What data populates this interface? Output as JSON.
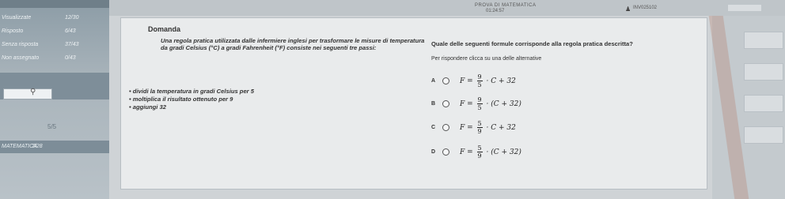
{
  "header": {
    "exam_title": "PROVA DI MATEMATICA",
    "timer": "01:24:57",
    "user_icon": "user-icon",
    "user_id": "INV025102",
    "close_icon": "close-icon"
  },
  "sidebar": {
    "rows": [
      {
        "label": "Visualizzate",
        "value": "12/30"
      },
      {
        "label": "Risposto",
        "value": "6/43"
      },
      {
        "label": "Senza risposta",
        "value": "37/43"
      },
      {
        "label": "Non assegnato",
        "value": "0/43"
      }
    ],
    "score": "5/5",
    "materia": {
      "label": "MATEMATICA",
      "value": "7/28"
    }
  },
  "question": {
    "label": "Domanda",
    "text": "Una regola pratica utilizzata dalle infermiere inglesi per trasformare le misure di temperatura da gradi Celsius (°C) a gradi Fahrenheit (°F) consiste nei seguenti tre passi:",
    "steps": [
      "• dividi la temperatura in gradi Celsius per 5",
      "• moltiplica il risultato ottenuto per 9",
      "• aggiungi 32"
    ]
  },
  "answer": {
    "title": "Quale delle seguenti formule corrisponde alla regola pratica descritta?",
    "instruction": "Per rispondere clicca su una delle alternative",
    "options": [
      {
        "letter": "A",
        "lhs": "F =",
        "num": "9",
        "den": "5",
        "rhs": "· C + 32"
      },
      {
        "letter": "B",
        "lhs": "F =",
        "num": "9",
        "den": "5",
        "rhs": "· (C + 32)"
      },
      {
        "letter": "C",
        "lhs": "F =",
        "num": "5",
        "den": "9",
        "rhs": "· C + 32"
      },
      {
        "letter": "D",
        "lhs": "F =",
        "num": "5",
        "den": "9",
        "rhs": "· (C + 32)"
      }
    ]
  },
  "colors": {
    "sidebar": "#8c9ca6",
    "panel": "#e9ebec",
    "background": "#cfd3d6"
  }
}
